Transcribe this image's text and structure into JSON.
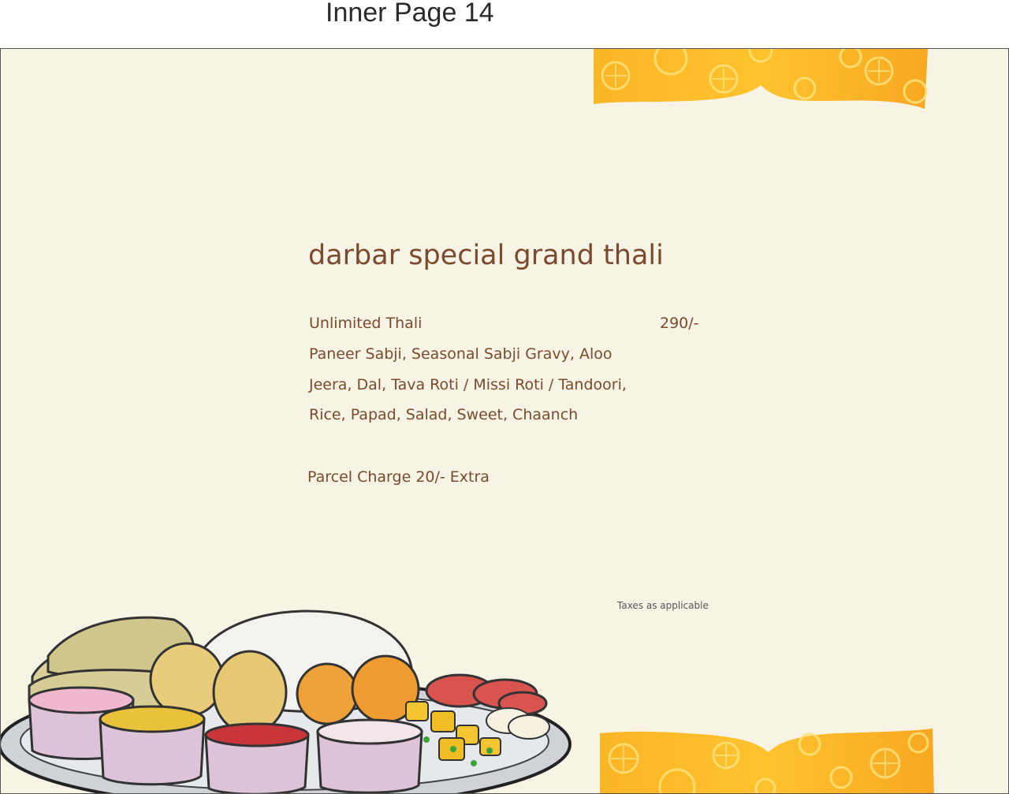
{
  "page_caption": "Inner Page 14",
  "menu": {
    "title": "darbar special grand thali",
    "item": {
      "name": "Unlimited Thali",
      "price": "290/-"
    },
    "description": [
      "Paneer Sabji, Seasonal Sabji Gravy, Aloo",
      "Jeera, Dal, Tava Roti / Missi Roti / Tandoori,",
      "Rice, Papad, Salad, Sweet, Chaanch"
    ],
    "parcel_note": "Parcel Charge 20/- Extra",
    "taxes_note": "Taxes as applicable"
  },
  "colors": {
    "page_background": "#f7f4e6",
    "text_brown": "#7a4a2c",
    "banner_orange": "#f5a623",
    "banner_yellow": "#ffc629"
  },
  "icons": [
    "orange-slice-pattern",
    "thali-plate-illustration"
  ]
}
